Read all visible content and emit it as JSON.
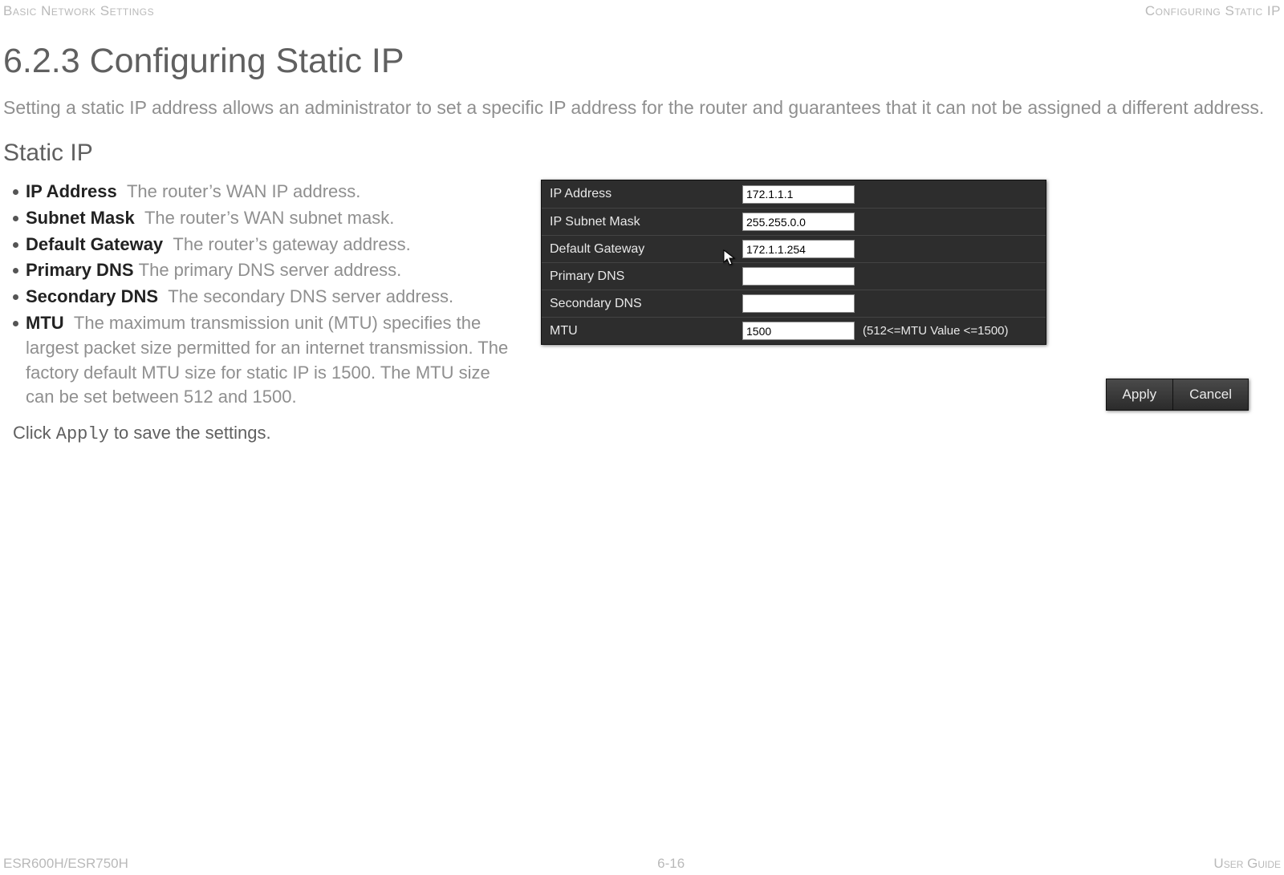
{
  "header": {
    "left": "Basic Network Settings",
    "right": "Configuring Static IP"
  },
  "title": "6.2.3 Configuring Static IP",
  "intro": "Setting a static IP address allows an administrator to set a specific IP address for the router and guarantees that it can not be assigned a different address.",
  "subhead": "Static IP",
  "bullets": [
    {
      "term": "IP Address",
      "desc": "The router’s WAN IP address."
    },
    {
      "term": "Subnet Mask",
      "desc": "The router’s WAN subnet mask."
    },
    {
      "term": "Default Gateway",
      "desc": "The router’s gateway address."
    },
    {
      "term": "Primary DNS",
      "desc": "The primary DNS server address."
    },
    {
      "term": "Secondary DNS",
      "desc": "The secondary DNS server address."
    },
    {
      "term": "MTU",
      "desc": "The maximum transmission unit (MTU) specifies the largest packet size permitted for an internet transmission. The factory default MTU size for static IP is 1500. The MTU size can be set between 512 and 1500."
    }
  ],
  "apply_line": {
    "pre": "Click ",
    "cmd": "Apply",
    "post": " to save the settings."
  },
  "form": {
    "rows": [
      {
        "label": "IP Address",
        "value": "172.1.1.1",
        "hint": ""
      },
      {
        "label": "IP Subnet Mask",
        "value": "255.255.0.0",
        "hint": ""
      },
      {
        "label": "Default Gateway",
        "value": "172.1.1.254",
        "hint": ""
      },
      {
        "label": "Primary DNS",
        "value": "",
        "hint": ""
      },
      {
        "label": "Secondary DNS",
        "value": "",
        "hint": ""
      },
      {
        "label": "MTU",
        "value": "1500",
        "hint": "(512<=MTU Value <=1500)"
      }
    ]
  },
  "buttons": {
    "apply": "Apply",
    "cancel": "Cancel"
  },
  "footer": {
    "left": "ESR600H/ESR750H",
    "center": "6-16",
    "right": "User Guide"
  }
}
